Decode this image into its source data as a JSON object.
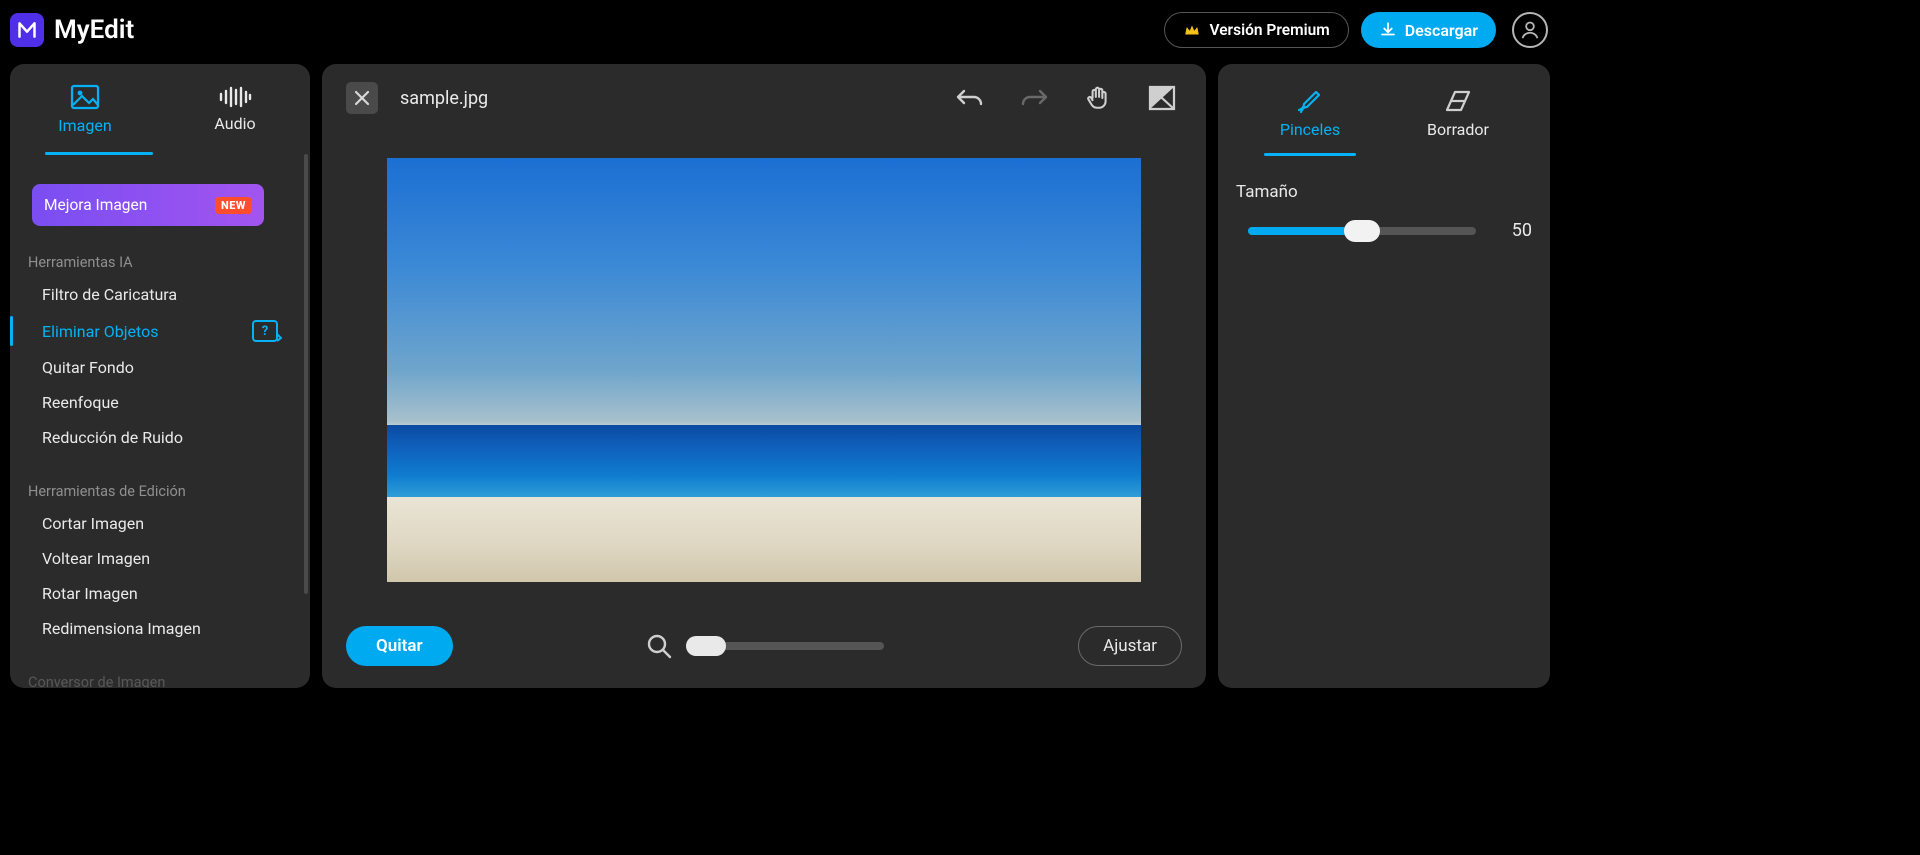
{
  "header": {
    "app_name": "MyEdit",
    "premium_label": "Versión Premium",
    "download_label": "Descargar"
  },
  "sidebar": {
    "tabs": {
      "image": "Imagen",
      "audio": "Audio"
    },
    "enhance_label": "Mejora Imagen",
    "enhance_badge": "NEW",
    "group_ai": "Herramientas IA",
    "ai_items": [
      "Filtro de Caricatura",
      "Eliminar Objetos",
      "Quitar Fondo",
      "Reenfoque",
      "Reducción de Ruido"
    ],
    "group_edit": "Herramientas de Edición",
    "edit_items": [
      "Cortar Imagen",
      "Voltear Imagen",
      "Rotar Imagen",
      "Redimensiona Imagen"
    ],
    "group_convert": "Conversor de Imagen"
  },
  "canvas": {
    "filename": "sample.jpg",
    "quitar_label": "Quitar",
    "ajustar_label": "Ajustar"
  },
  "right": {
    "tabs": {
      "brush": "Pinceles",
      "eraser": "Borrador"
    },
    "size_label": "Tamaño",
    "size_value": "50"
  }
}
